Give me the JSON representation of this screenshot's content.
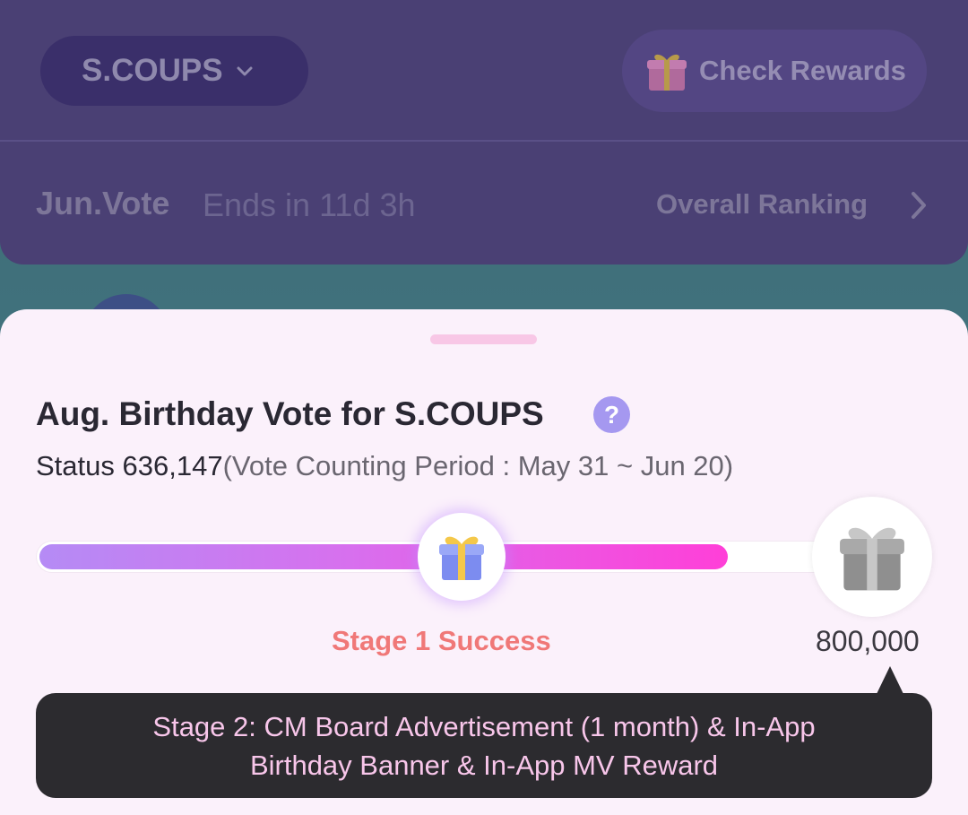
{
  "header": {
    "member_name": "S.COUPS",
    "check_rewards_label": "Check Rewards",
    "vote_title": "Jun.Vote",
    "vote_ends": "Ends in 11d 3h",
    "overall_ranking_label": "Overall Ranking"
  },
  "sheet": {
    "title": "Aug. Birthday Vote for S.COUPS",
    "help_glyph": "?",
    "status_label": "Status",
    "status_value": "636,147",
    "period_text": "(Vote Counting Period : May 31 ~ Jun 20)",
    "progress": {
      "current": 636147,
      "target": 800000,
      "fill_fraction": 0.8
    },
    "stage1_label": "Stage 1 Success",
    "stage2_target": "800,000",
    "tooltip_line1": "Stage 2: CM Board Advertisement (1 month) & In-App",
    "tooltip_line2": "Birthday Banner & In-App MV Reward"
  },
  "icons": {
    "dropdown": "chevron-down-icon",
    "rewards": "gift-icon",
    "ranking": "chevron-right-icon",
    "help": "question-icon",
    "stage1": "gift-icon",
    "stage2": "gift-icon"
  },
  "colors": {
    "accent_pink": "#ff3fd8",
    "accent_purple": "#b58bf5",
    "success_red": "#f07878",
    "tooltip_text": "#f8c6ea",
    "sheet_bg": "#fbf1fb"
  }
}
